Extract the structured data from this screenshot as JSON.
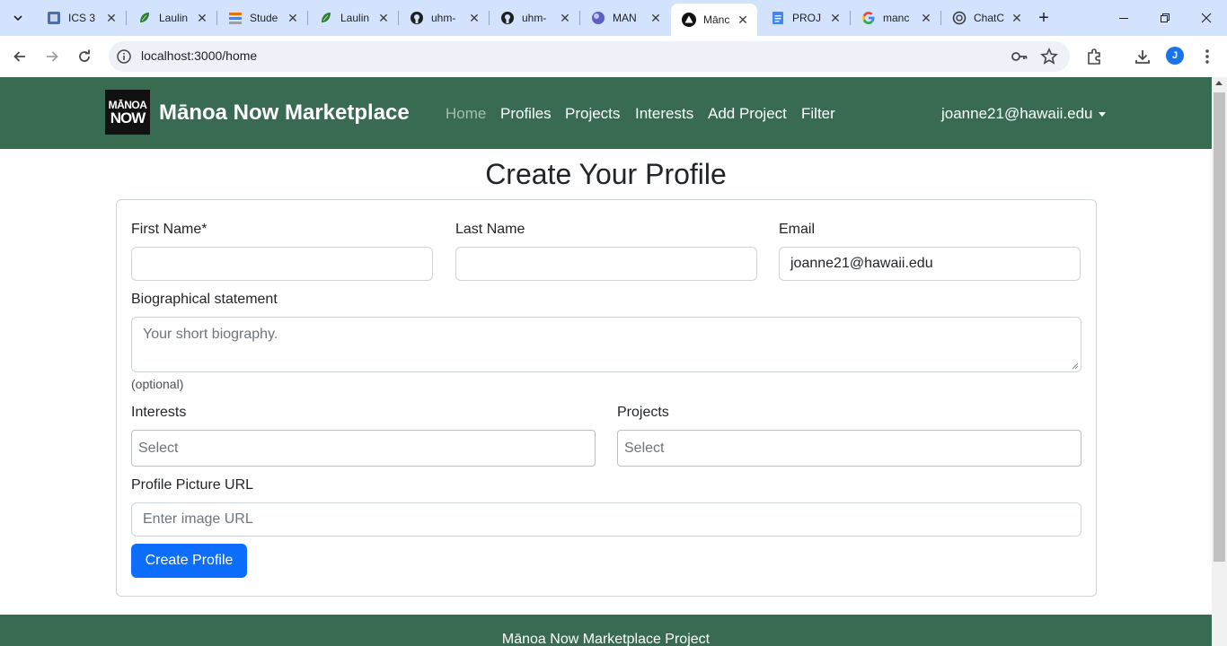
{
  "browser": {
    "tabs": [
      {
        "title": "ICS 3",
        "icon": "square-app-icon",
        "color": "#4a6fa5"
      },
      {
        "title": "Laulin",
        "icon": "leaf-icon",
        "color": "#2e7d32"
      },
      {
        "title": "Stude",
        "icon": "stack-icon",
        "color": "#e8710a"
      },
      {
        "title": "Laulin",
        "icon": "leaf-icon",
        "color": "#2e7d32"
      },
      {
        "title": "uhm-",
        "icon": "github-icon",
        "color": "#1f1f1f"
      },
      {
        "title": "uhm-",
        "icon": "github-icon",
        "color": "#1f1f1f"
      },
      {
        "title": "MAN",
        "icon": "orb-icon",
        "color": "#5b5fc7"
      },
      {
        "title": "Mānc",
        "icon": "triangle-app-icon",
        "color": "#111111"
      },
      {
        "title": "PROJ",
        "icon": "doc-icon",
        "color": "#4285f4"
      },
      {
        "title": "manc",
        "icon": "google-icon",
        "color": "#4285f4"
      },
      {
        "title": "ChatC",
        "icon": "chatgpt-icon",
        "color": "#333333"
      }
    ],
    "active_tab_index": 7,
    "url": "localhost:3000/home",
    "profile_initial": "J"
  },
  "navbar": {
    "logo_line1": "MĀNOA",
    "logo_line2": "NOW",
    "brand": "Mānoa Now Marketplace",
    "links": [
      "Home",
      "Profiles",
      "Projects",
      "Interests",
      "Add Project",
      "Filter"
    ],
    "user": "joanne21@hawaii.edu"
  },
  "form": {
    "title": "Create Your Profile",
    "first_name_label": "First Name*",
    "first_name_value": "",
    "last_name_label": "Last Name",
    "last_name_value": "",
    "email_label": "Email",
    "email_value": "joanne21@hawaii.edu",
    "bio_label": "Biographical statement",
    "bio_placeholder": "Your short biography.",
    "bio_help": "(optional)",
    "interests_label": "Interests",
    "interests_placeholder": "Select",
    "projects_label": "Projects",
    "projects_placeholder": "Select",
    "picture_label": "Profile Picture URL",
    "picture_placeholder": "Enter image URL",
    "submit_label": "Create Profile"
  },
  "footer": {
    "text": "Mānoa Now Marketplace Project"
  },
  "colors": {
    "navbar": "#386b52",
    "primary": "#0d6efd",
    "tabbar": "#d3e3fd"
  }
}
